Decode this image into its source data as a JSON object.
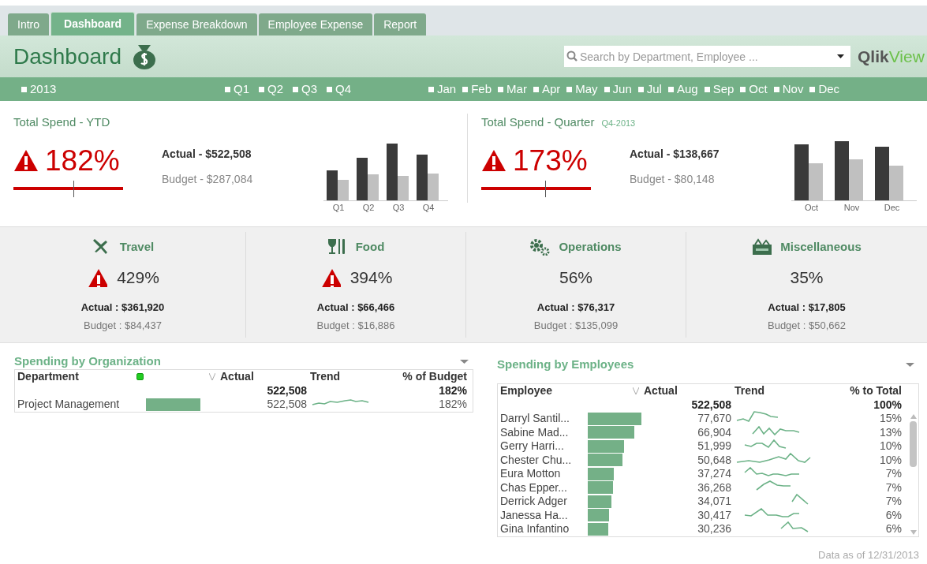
{
  "tabs": [
    {
      "label": "Intro",
      "selected": false
    },
    {
      "label": "Dashboard",
      "selected": true
    },
    {
      "label": "Expense Breakdown",
      "selected": false
    },
    {
      "label": "Employee Expense",
      "selected": false
    },
    {
      "label": "Report",
      "selected": false
    }
  ],
  "header": {
    "title": "Dashboard",
    "search": {
      "placeholder": "Search by Department, Employee ..."
    },
    "logo": {
      "part1": "Qlik",
      "part2": "View"
    }
  },
  "filters": {
    "years": [
      {
        "label": "2013",
        "checked": false
      }
    ],
    "quarters": [
      {
        "label": "Q1",
        "checked": false
      },
      {
        "label": "Q2",
        "checked": false
      },
      {
        "label": "Q3",
        "checked": false
      },
      {
        "label": "Q4",
        "checked": false
      }
    ],
    "months": [
      {
        "label": "Jan",
        "checked": false
      },
      {
        "label": "Feb",
        "checked": false
      },
      {
        "label": "Mar",
        "checked": false
      },
      {
        "label": "Apr",
        "checked": false
      },
      {
        "label": "May",
        "checked": false
      },
      {
        "label": "Jun",
        "checked": false
      },
      {
        "label": "Jul",
        "checked": false
      },
      {
        "label": "Aug",
        "checked": false
      },
      {
        "label": "Sep",
        "checked": false
      },
      {
        "label": "Oct",
        "checked": false
      },
      {
        "label": "Nov",
        "checked": false
      },
      {
        "label": "Dec",
        "checked": false
      }
    ]
  },
  "kpis": [
    {
      "title": "Total Spend - YTD",
      "percent": "182%",
      "alert": true,
      "actual": "Actual - $522,508",
      "budget": "Budget - $287,084",
      "gauge": {
        "level": 0.55
      },
      "chart_labels": [
        "Q1",
        "Q2",
        "Q3",
        "Q4"
      ]
    },
    {
      "title": "Total Spend - Quarter",
      "subtitle": "Q4-2013",
      "percent": "173%",
      "alert": true,
      "actual": "Actual - $138,667",
      "budget": "Budget - $80,148",
      "gauge": {
        "level": 0.58
      },
      "chart_labels": [
        "Oct",
        "Nov",
        "Dec"
      ]
    }
  ],
  "categories": [
    {
      "kind": "travel",
      "title": "Travel",
      "percent": "429%",
      "alert": true,
      "actual": "Actual : $361,920",
      "budget": "Budget : $84,437"
    },
    {
      "kind": "food",
      "title": "Food",
      "percent": "394%",
      "alert": true,
      "actual": "Actual : $66,466",
      "budget": "Budget : $16,886"
    },
    {
      "kind": "operations",
      "title": "Operations",
      "percent": "56%",
      "alert": false,
      "actual": "Actual : $76,317",
      "budget": "Budget : $135,099"
    },
    {
      "kind": "misc",
      "title": "Miscellaneous",
      "percent": "35%",
      "alert": false,
      "actual": "Actual : $17,805",
      "budget": "Budget : $50,662"
    }
  ],
  "organization": {
    "title": "Spending by Organization",
    "columns": [
      "Department",
      "Actual",
      "Trend",
      "% of Budget"
    ],
    "totals": {
      "actual": "522,508",
      "percent": "182%"
    },
    "rows": [
      {
        "name": "Project Management",
        "actual": "522,508",
        "percent": "182%"
      }
    ]
  },
  "employees": {
    "title": "Spending by Employees",
    "columns": [
      "Employee",
      "Actual",
      "Trend",
      "% to Total"
    ],
    "totals": {
      "actual": "522,508",
      "percent": "100%"
    },
    "rows": [
      {
        "name": "Darryl Santil...",
        "actual": "77,670",
        "percent": "15%"
      },
      {
        "name": "Sabine Mad...",
        "actual": "66,904",
        "percent": "13%"
      },
      {
        "name": "Gerry Harri...",
        "actual": "51,999",
        "percent": "10%"
      },
      {
        "name": "Chester Chu...",
        "actual": "50,648",
        "percent": "10%"
      },
      {
        "name": "Eura Motton",
        "actual": "37,274",
        "percent": "7%"
      },
      {
        "name": "Chas Epper...",
        "actual": "36,268",
        "percent": "7%"
      },
      {
        "name": "Derrick Adger",
        "actual": "34,071",
        "percent": "7%"
      },
      {
        "name": "Janessa Ha...",
        "actual": "30,417",
        "percent": "6%"
      },
      {
        "name": "Gina Infantino",
        "actual": "30,236",
        "percent": "6%"
      }
    ]
  },
  "footer": "Data as of 12/31/2013"
}
